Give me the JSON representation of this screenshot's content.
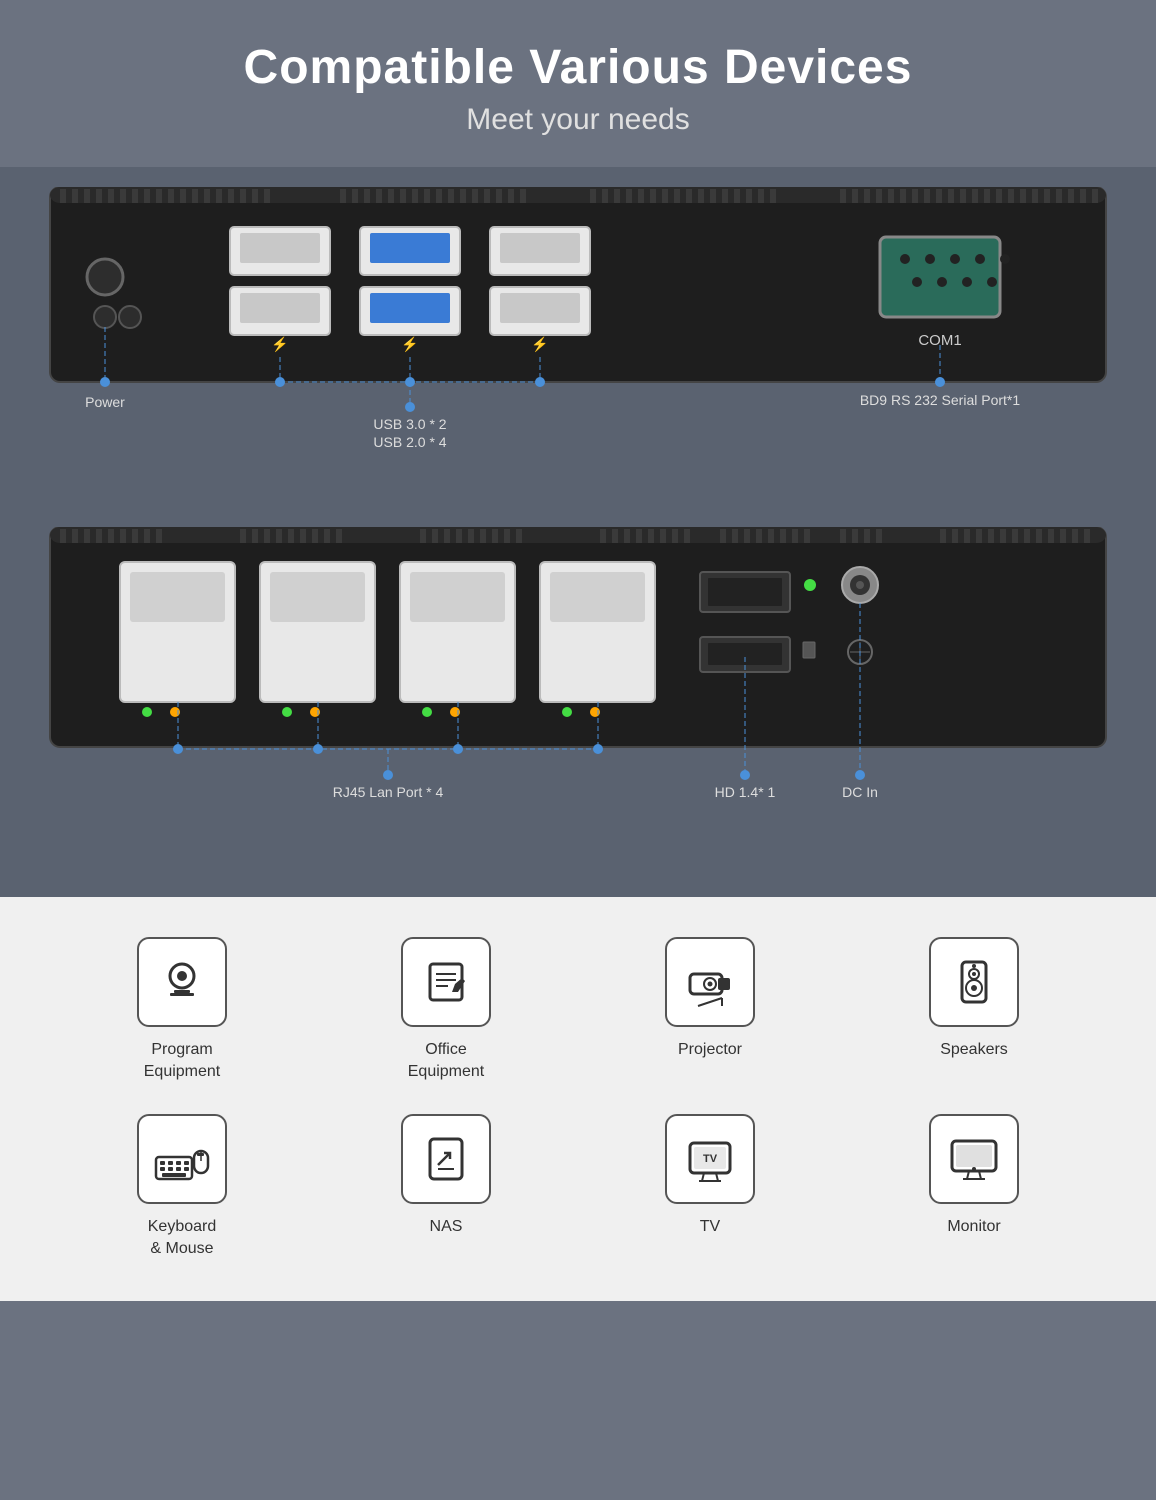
{
  "header": {
    "title": "Compatible Various Devices",
    "subtitle": "Meet your needs"
  },
  "top_panel": {
    "labels": {
      "power": "Power",
      "usb": "USB 3.0 * 2\nUSB 2.0 * 4",
      "com": "BD9 RS 232 Serial Port*1",
      "com_label": "COM1"
    }
  },
  "bottom_panel": {
    "labels": {
      "lan": "RJ45 Lan Port * 4",
      "hd": "HD 1.4* 1",
      "dc": "DC In"
    }
  },
  "icons": [
    {
      "id": "program-equipment",
      "icon": "🖥️",
      "label": "Program\nEquipment",
      "unicode": "📷"
    },
    {
      "id": "office-equipment",
      "icon": "📋",
      "label": "Office\nEquipment",
      "unicode": "✈"
    },
    {
      "id": "projector",
      "icon": "📽️",
      "label": "Projector",
      "unicode": "📽"
    },
    {
      "id": "speakers",
      "icon": "🔊",
      "label": "Speakers",
      "unicode": "🔊"
    },
    {
      "id": "keyboard-mouse",
      "icon": "⌨️",
      "label": "Keyboard\n& Mouse",
      "unicode": "⌨"
    },
    {
      "id": "nas",
      "icon": "💾",
      "label": "NAS",
      "unicode": "🗄"
    },
    {
      "id": "tv",
      "icon": "📺",
      "label": "TV",
      "unicode": "📺"
    },
    {
      "id": "monitor",
      "icon": "🖥️",
      "label": "Monitor",
      "unicode": "🖥"
    }
  ],
  "colors": {
    "background": "#6b7280",
    "title_color": "#ffffff",
    "subtitle_color": "#e0e0e0",
    "accent_blue": "#4a90d9",
    "panel_dark": "#1a1a1a",
    "icons_bg": "#f0f0f0"
  }
}
